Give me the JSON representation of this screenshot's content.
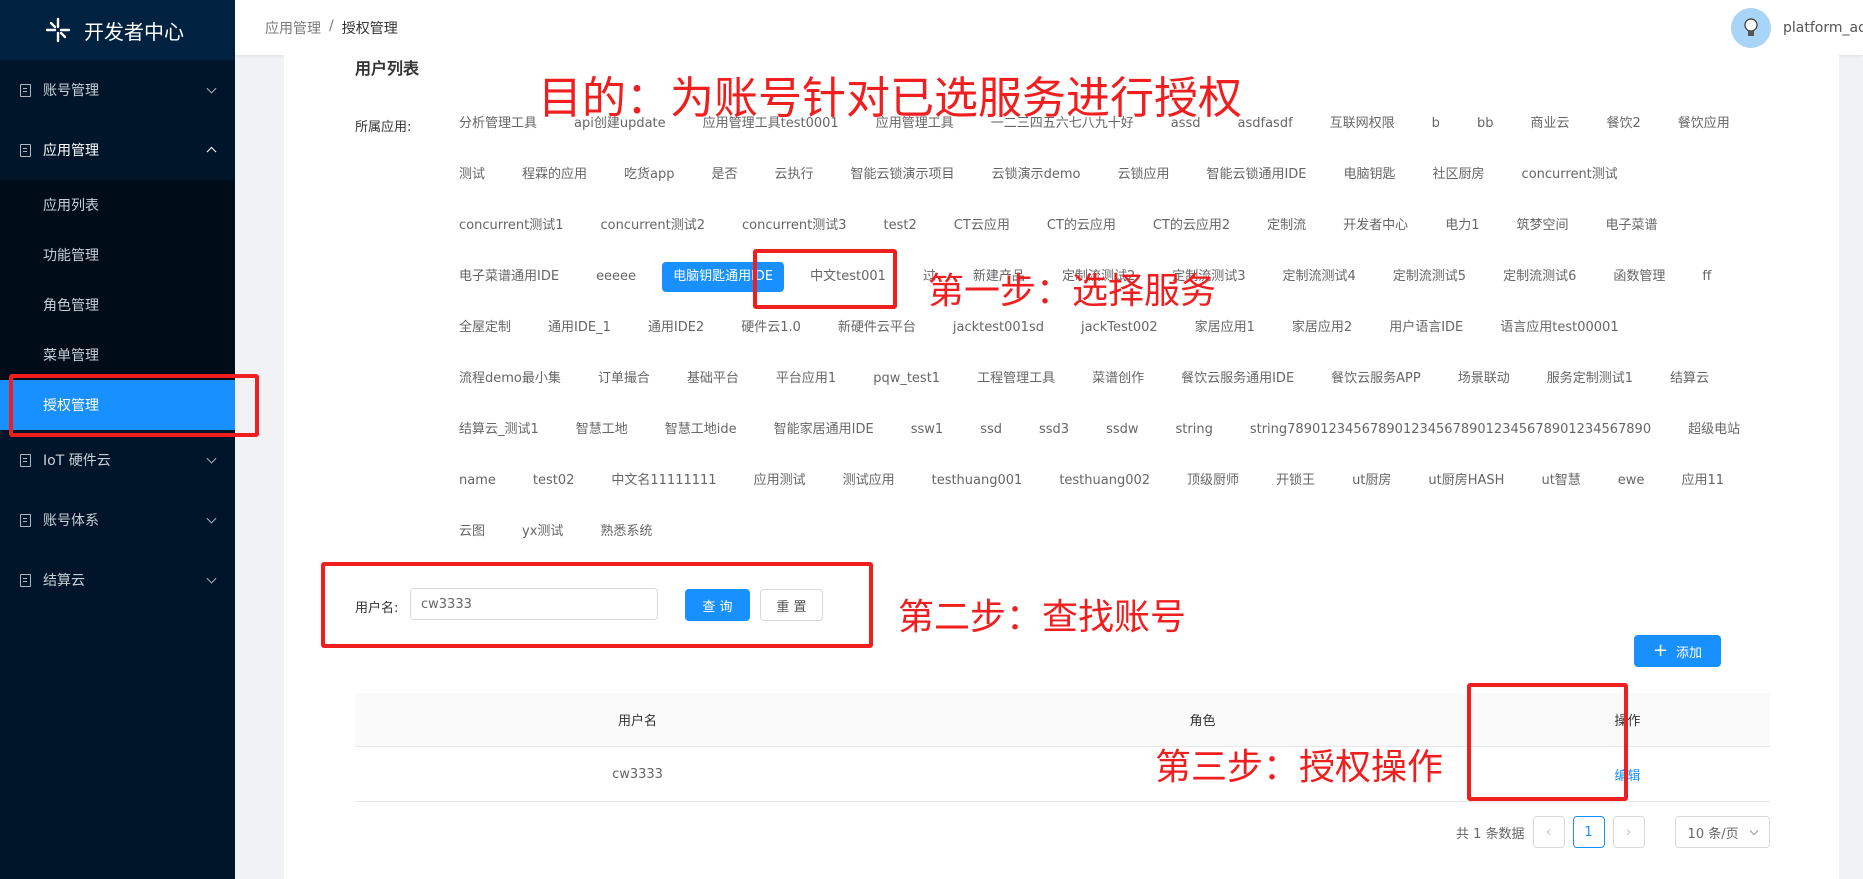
{
  "sidebar": {
    "title": "开发者中心",
    "menus": [
      {
        "label": "账号管理"
      },
      {
        "label": "应用管理"
      },
      {
        "label": "IoT 硬件云"
      },
      {
        "label": "账号体系"
      },
      {
        "label": "结算云"
      }
    ],
    "submenu": [
      "应用列表",
      "功能管理",
      "角色管理",
      "菜单管理",
      "授权管理"
    ]
  },
  "header": {
    "breadcrumb": [
      "应用管理",
      "/",
      "授权管理"
    ],
    "username": "platform_ad"
  },
  "main": {
    "section_title": "用户列表",
    "filter_label": "所属应用:",
    "app_tags": [
      "分析管理工具",
      "api创建update",
      "应用管理工具test0001",
      "应用管理工具",
      "一二三四五六七八九十好",
      "assd",
      "asdfasdf",
      "互联网权限",
      "b",
      "bb",
      "商业云",
      "餐饮2",
      "餐饮应用",
      "测试",
      "程霖的应用",
      "吃货app",
      "是否",
      "云执行",
      "智能云锁演示项目",
      "云锁演示demo",
      "云锁应用",
      "智能云锁通用IDE",
      "电脑钥匙",
      "社区厨房",
      "concurrent测试",
      "concurrent测试1",
      "concurrent测试2",
      "concurrent测试3",
      "test2",
      "CT云应用",
      "CT的云应用",
      "CT的云应用2",
      "定制流",
      "开发者中心",
      "电力1",
      "筑梦空间",
      "电子菜谱",
      "电子菜谱通用IDE",
      "eeeee",
      "电脑钥匙通用IDE",
      "中文test001",
      "过",
      "新建产品",
      "定制流测试2",
      "定制流测试3",
      "定制流测试4",
      "定制流测试5",
      "定制流测试6",
      "函数管理",
      "ff",
      "全屋定制",
      "通用IDE_1",
      "通用IDE2",
      "硬件云1.0",
      "新硬件云平台",
      "jacktest001sd",
      "jackTest002",
      "家居应用1",
      "家居应用2",
      "用户语言IDE",
      "语言应用test00001",
      "流程demo最小集",
      "订单撮合",
      "基础平台",
      "平台应用1",
      "pqw_test1",
      "工程管理工具",
      "菜谱创作",
      "餐饮云服务通用IDE",
      "餐饮云服务APP",
      "场景联动",
      "服务定制测试1",
      "结算云",
      "结算云_测试1",
      "智慧工地",
      "智慧工地ide",
      "智能家居通用IDE",
      "ssw1",
      "ssd",
      "ssd3",
      "ssdw",
      "string",
      "string78901234567890123456789012345678901234567890",
      "超级电站",
      "name",
      "test02",
      "中文名11111111",
      "应用测试",
      "测试应用",
      "testhuang001",
      "testhuang002",
      "顶级厨师",
      "开锁王",
      "ut厨房",
      "ut厨房HASH",
      "ut智慧",
      "ewe",
      "应用11",
      "云图",
      "yx测试",
      "熟悉系统"
    ],
    "selected_tag_index": 39,
    "search": {
      "label": "用户名:",
      "value": "cw3333",
      "query_label": "查 询",
      "reset_label": "重 置"
    },
    "add_label": "添加",
    "table": {
      "headers": [
        "用户名",
        "角色",
        "操作"
      ],
      "rows": [
        {
          "username": "cw3333",
          "role": "",
          "action": "编辑"
        }
      ]
    },
    "pagination": {
      "total_text": "共 1 条数据",
      "current_page": "1",
      "page_size": "10 条/页"
    }
  },
  "annotations": {
    "goal": "目的：为账号针对已选服务进行授权",
    "step1": "第一步：选择服务",
    "step2": "第二步：查找账号",
    "step3": "第三步：授权操作"
  },
  "colors": {
    "sidebar_bg": "#001529",
    "accent": "#1890ff",
    "annotation_red": "#f01e1e"
  }
}
